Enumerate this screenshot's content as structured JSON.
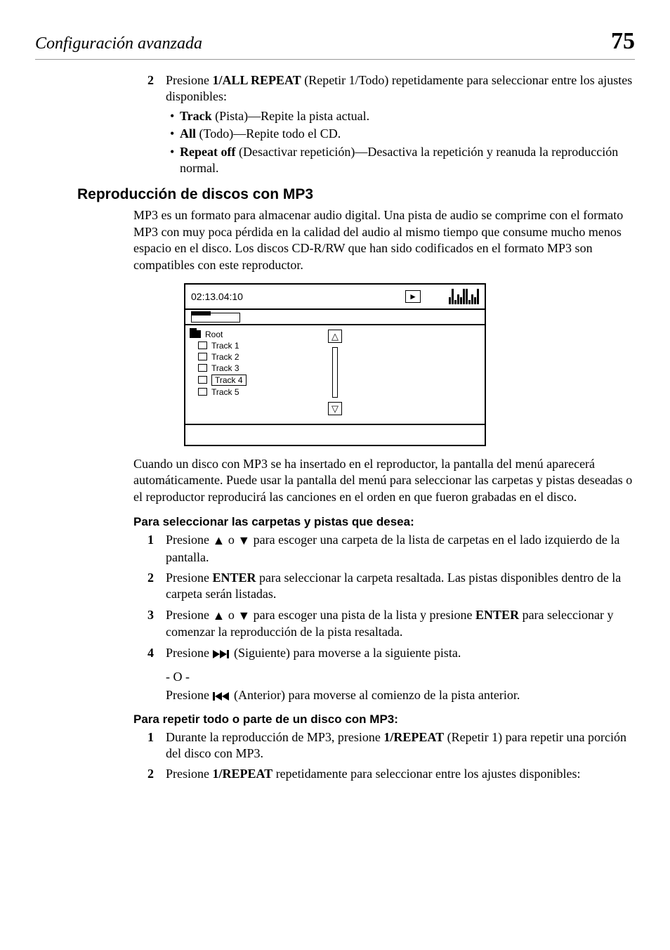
{
  "header": {
    "section_title": "Configuración avanzada",
    "page_number": "75"
  },
  "steps_a": [
    {
      "num": "2",
      "pre": "Presione ",
      "bold": "1/ALL REPEAT",
      "post": " (Repetir 1/Todo) repetidamente para seleccionar entre los ajustes disponibles:",
      "bullets": [
        {
          "bold": "Track",
          "rest": " (Pista)—Repite la pista actual."
        },
        {
          "bold": "All",
          "rest": " (Todo)—Repite todo el CD."
        },
        {
          "bold": "Repeat off",
          "rest": " (Desactivar repetición)—Desactiva la repetición y reanuda la reproducción normal."
        }
      ]
    }
  ],
  "heading_mp3": "Reproducción de discos con MP3",
  "para_mp3_intro": "MP3 es un formato para almacenar audio digital. Una pista de audio se comprime con el formato MP3 con muy poca pérdida en la calidad del audio al mismo tiempo que consume mucho menos espacio en el disco. Los discos CD-R/RW que han sido codificados en el formato MP3 son compatibles con este reproductor.",
  "screen": {
    "time": "02:13.04:10",
    "play_glyph": "►",
    "root_label": "Root",
    "tracks": [
      "Track 1",
      "Track 2",
      "Track 3",
      "Track 4",
      "Track 5"
    ],
    "arrow_up": "△",
    "arrow_down": "▽"
  },
  "para_after_screen": "Cuando un disco con MP3 se ha insertado en el reproductor, la pantalla del menú aparecerá automáticamente. Puede usar la pantalla del menú para seleccionar las carpetas y pistas deseadas o el reproductor reproducirá las canciones en el orden en que fueron grabadas en el disco.",
  "subhead_select": "Para seleccionar las carpetas y pistas que desea:",
  "steps_select": {
    "s1": {
      "num": "1",
      "pre": "Presione ",
      "post": " para escoger una carpeta de la lista de carpetas en el lado izquierdo de la pantalla.",
      "or_word": " o "
    },
    "s2": {
      "num": "2",
      "pre": "Presione ",
      "bold": "ENTER",
      "post": " para seleccionar la carpeta resaltada. Las pistas disponibles dentro de la carpeta serán listadas."
    },
    "s3": {
      "num": "3",
      "pre": "Presione ",
      "or_word": " o ",
      "mid": " para escoger una pista de la lista y presione ",
      "bold": "ENTER",
      "post": " para seleccionar y comenzar la reproducción de la pista resaltada."
    },
    "s4": {
      "num": "4",
      "pre": "Presione ",
      "post": " (Siguiente) para moverse a la siguiente pista."
    },
    "dash_o": "- O -",
    "s4b": {
      "pre": "Presione ",
      "post": " (Anterior) para moverse al comienzo de la pista anterior."
    }
  },
  "subhead_repeat": "Para repetir todo o parte de un disco con MP3:",
  "steps_repeat": {
    "s1": {
      "num": "1",
      "pre": "Durante la reproducción de MP3, presione ",
      "bold": "1/REPEAT",
      "post": " (Repetir 1) para repetir una porción del disco con MP3."
    },
    "s2": {
      "num": "2",
      "pre": "Presione ",
      "bold": "1/REPEAT",
      "post": " repetidamente para seleccionar entre los ajustes disponibles:"
    }
  },
  "icons": {
    "tri_up": "▲",
    "tri_down": "▼"
  }
}
